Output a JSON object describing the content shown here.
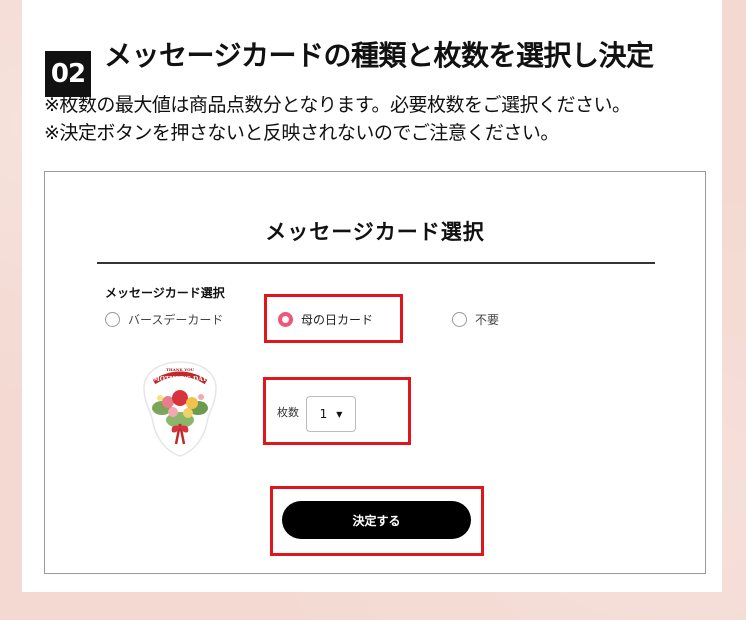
{
  "step": {
    "number": "02",
    "title": "メッセージカードの種類と枚数を選択し決定"
  },
  "notes": [
    "※枚数の最大値は商品点数分となります。必要枚数をご選択ください。",
    "※決定ボタンを押さないと反映されないのでご注意ください。"
  ],
  "modal": {
    "title": "メッセージカード選択",
    "section_label": "メッセージカード選択",
    "options": [
      {
        "label": "バースデーカード",
        "selected": false
      },
      {
        "label": "母の日カード",
        "selected": true
      },
      {
        "label": "不要",
        "selected": false
      }
    ],
    "quantity": {
      "label": "枚数",
      "value": "1"
    },
    "submit_label": "決定する",
    "card_image_text": {
      "line1": "THANK YOU",
      "line2": "MOTHER'S DAY"
    }
  },
  "colors": {
    "highlight": "#e0161d",
    "radio_selected": "#f0567a",
    "page_background": "#f3d9d1"
  }
}
